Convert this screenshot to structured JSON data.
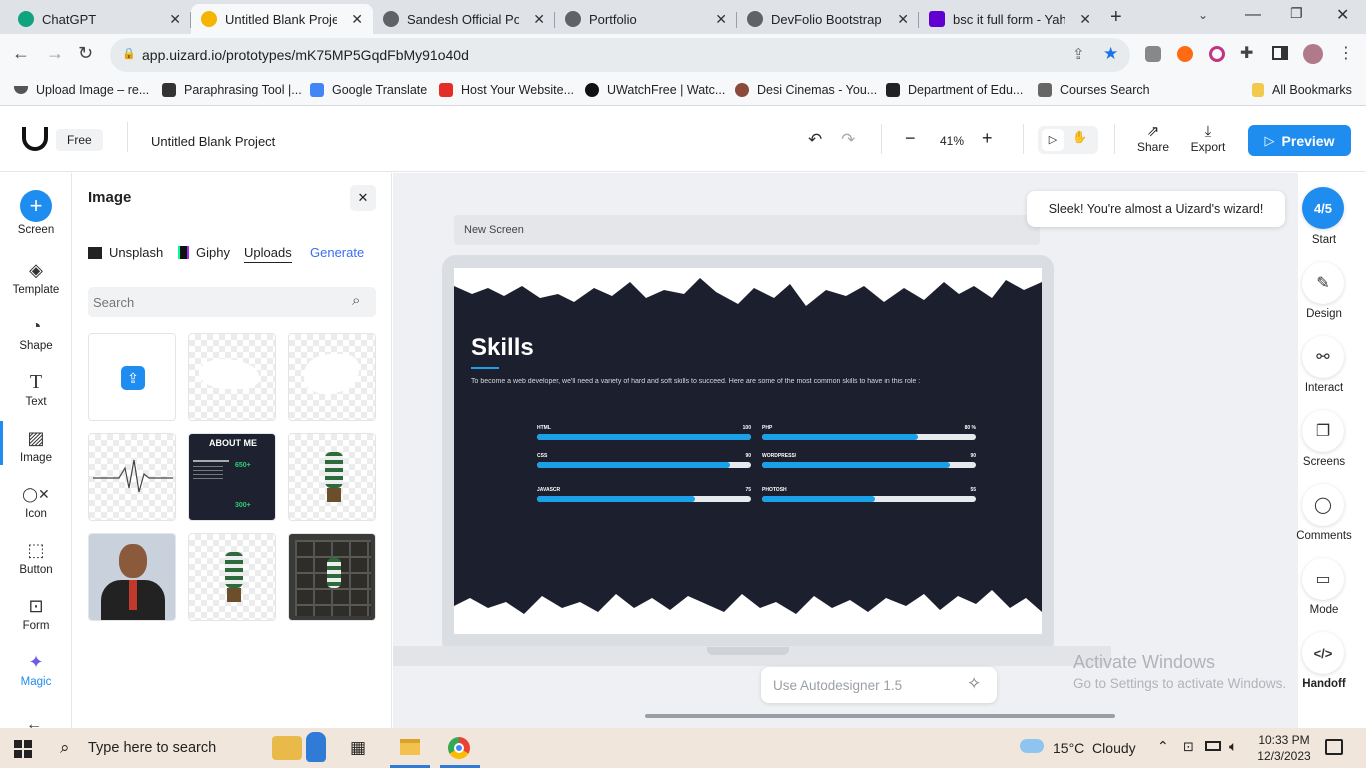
{
  "browser": {
    "tabs": [
      {
        "title": "ChatGPT",
        "color": "#10a37f",
        "active": false
      },
      {
        "title": "Untitled Blank Project",
        "color": "#f4b400",
        "active": true
      },
      {
        "title": "Sandesh Official Portf",
        "color": "#5f6368",
        "active": false
      },
      {
        "title": "Portfolio",
        "color": "#5f6368",
        "active": false
      },
      {
        "title": "DevFolio Bootstrap Te",
        "color": "#5f6368",
        "active": false
      },
      {
        "title": "bsc it full form - Yaho",
        "color": "#6001d2",
        "active": false
      }
    ],
    "url": "app.uizard.io/prototypes/mK75MP5GqdFbMy91o40d",
    "bookmarks": [
      {
        "label": "Upload Image – re...",
        "color": "#555"
      },
      {
        "label": "Paraphrasing Tool |...",
        "color": "#333"
      },
      {
        "label": "Google Translate",
        "color": "#4285f4"
      },
      {
        "label": "Host Your Website...",
        "color": "#e52d27"
      },
      {
        "label": "UWatchFree | Watc...",
        "color": "#111"
      },
      {
        "label": "Desi Cinemas - You...",
        "color": "#8b4a3a"
      },
      {
        "label": "Department of Edu...",
        "color": "#222"
      },
      {
        "label": "Courses Search",
        "color": "#666"
      }
    ],
    "all_bookmarks": "All Bookmarks"
  },
  "app": {
    "plan": "Free",
    "project_name": "Untitled Blank Project",
    "zoom": "41%",
    "share": "Share",
    "export": "Export",
    "preview": "Preview",
    "accent": "#1f8cf0"
  },
  "rail": {
    "items": [
      "Screen",
      "Template",
      "Shape",
      "Text",
      "Image",
      "Icon",
      "Button",
      "Form",
      "Magic"
    ]
  },
  "panel": {
    "title": "Image",
    "sources": [
      "Unsplash",
      "Giphy",
      "Uploads",
      "Generate"
    ],
    "search_placeholder": "Search",
    "about_title": "ABOUT ME",
    "stat1": "650+",
    "stat2": "300+"
  },
  "canvas": {
    "screen_name": "New Screen",
    "heading": "Skills",
    "intro": "To become a web developer, we'll need a variety of hard and soft skills to succeed. Here are some of the most common skills to have in this role :",
    "skills": [
      {
        "name": "HTML",
        "value": "100",
        "fill": 1.0
      },
      {
        "name": "PHP",
        "value": "80 %",
        "fill": 0.73
      },
      {
        "name": "CSS",
        "value": "90",
        "fill": 0.9
      },
      {
        "name": "WORDPRESS/",
        "value": "90",
        "fill": 0.88
      },
      {
        "name": "JAVASCR",
        "value": "75",
        "fill": 0.74
      },
      {
        "name": "PHOTOSH",
        "value": "55",
        "fill": 0.53
      }
    ],
    "autodesigner_placeholder": "Use Autodesigner 1.5",
    "wizard_msg": "Sleek! You're almost a Uizard's wizard!"
  },
  "right_rail": {
    "progress": "4/5",
    "items": [
      "Start",
      "Design",
      "Interact",
      "Screens",
      "Comments",
      "Mode",
      "Handoff"
    ]
  },
  "watermark": {
    "line1": "Activate Windows",
    "line2": "Go to Settings to activate Windows."
  },
  "taskbar": {
    "search_placeholder": "Type here to search",
    "weather": "15°C  Cloudy",
    "time": "10:33 PM",
    "date": "12/3/2023"
  }
}
